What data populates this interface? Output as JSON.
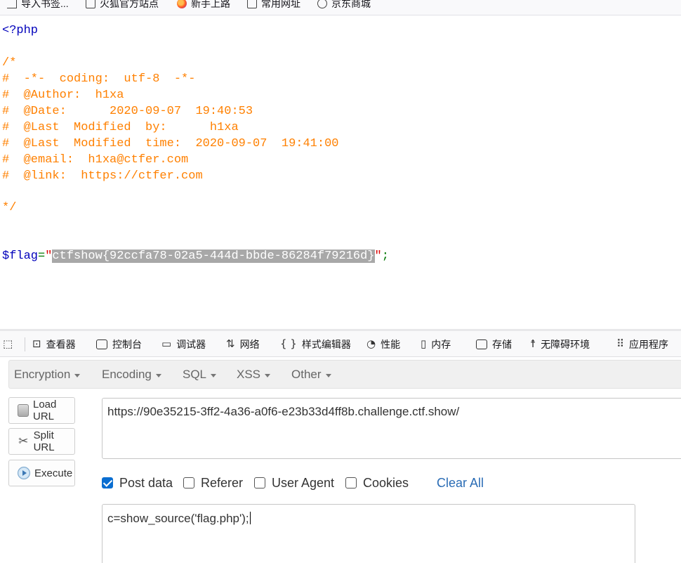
{
  "bookmarks": [
    {
      "label": "导入书签...",
      "icon": "import-icon"
    },
    {
      "label": "火狐官方站点",
      "icon": "folder-icon"
    },
    {
      "label": "新手上路",
      "icon": "firefox-icon"
    },
    {
      "label": "常用网址",
      "icon": "folder-icon"
    },
    {
      "label": "京东商城",
      "icon": "globe-icon"
    }
  ],
  "source": {
    "open_tag": "<?php",
    "comment_open": "/*",
    "comment_lines": [
      "#  -*-  coding:  utf-8  -*-",
      "#  @Author:  h1xa",
      "#  @Date:      2020-09-07  19:40:53",
      "#  @Last  Modified  by:      h1xa",
      "#  @Last  Modified  time:  2020-09-07  19:41:00",
      "#  @email:  h1xa@ctfer.com",
      "#  @link:  https://ctfer.com"
    ],
    "comment_close": "*/",
    "flag_var": "$flag",
    "flag_eq": "=",
    "quote_open": "\"",
    "flag_value": "ctfshow{92ccfa78-02a5-444d-bbde-86284f79216d}",
    "quote_close": "\"",
    "semicolon": ";"
  },
  "devtools": {
    "tabs": [
      {
        "label": "查看器",
        "icon": "inspector-icon"
      },
      {
        "label": "控制台",
        "icon": "console-icon"
      },
      {
        "label": "调试器",
        "icon": "debugger-icon"
      },
      {
        "label": "网络",
        "icon": "network-icon"
      },
      {
        "label": "样式编辑器",
        "icon": "style-editor-icon"
      },
      {
        "label": "性能",
        "icon": "performance-icon"
      },
      {
        "label": "内存",
        "icon": "memory-icon"
      },
      {
        "label": "存储",
        "icon": "storage-icon"
      },
      {
        "label": "无障碍环境",
        "icon": "accessibility-icon"
      },
      {
        "label": "应用程序",
        "icon": "application-icon"
      }
    ]
  },
  "hackbar": {
    "menu": [
      "Encryption",
      "Encoding",
      "SQL",
      "XSS",
      "Other"
    ],
    "buttons": {
      "load_url": "Load URL",
      "split_url": "Split URL",
      "execute": "Execute"
    },
    "url_value": "https://90e35215-3ff2-4a36-a0f6-e23b33d4ff8b.challenge.ctf.show/",
    "options": [
      {
        "label": "Post data",
        "checked": true
      },
      {
        "label": "Referer",
        "checked": false
      },
      {
        "label": "User Agent",
        "checked": false
      },
      {
        "label": "Cookies",
        "checked": false
      }
    ],
    "clear_all": "Clear All",
    "post_value": "c=show_source('flag.php');"
  },
  "colors": {
    "comment": "#ff8000",
    "php_tag": "#0000bb",
    "string": "#dd0000",
    "checkbox_on": "#0a6ed1",
    "link": "#2a6cb5"
  }
}
